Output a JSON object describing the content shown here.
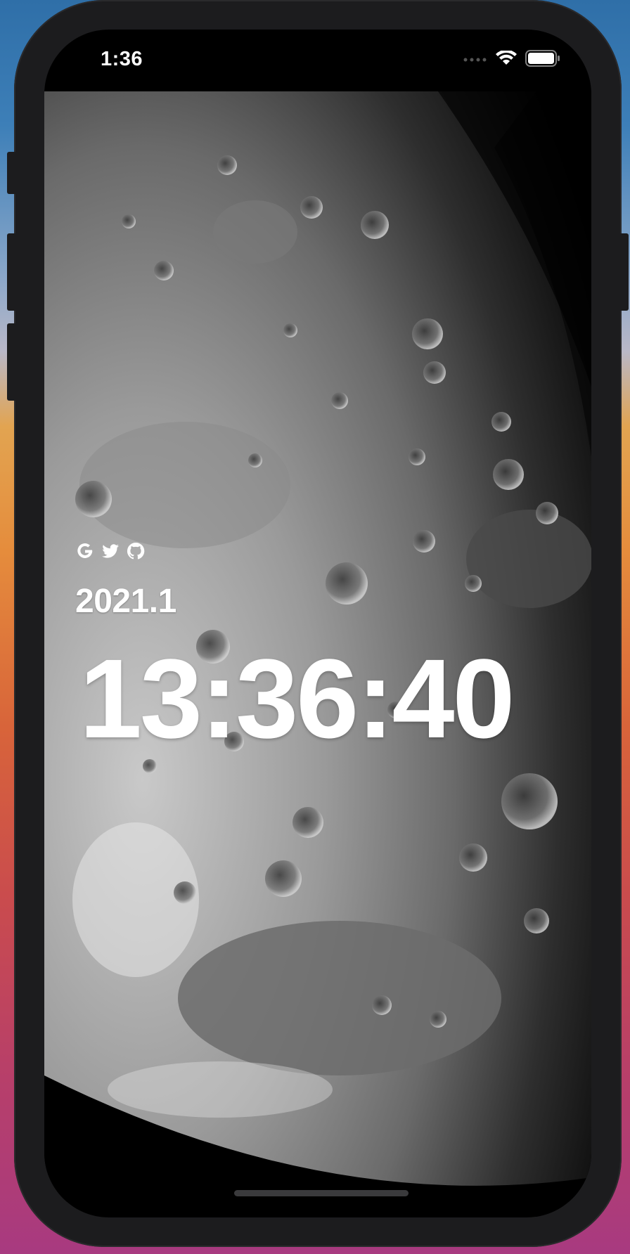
{
  "status_bar": {
    "time": "1:36",
    "signal_icon": "signal-dots-icon",
    "wifi_icon": "wifi-icon",
    "battery_icon": "battery-icon"
  },
  "social_links": [
    {
      "name": "google",
      "icon": "google-icon"
    },
    {
      "name": "twitter",
      "icon": "twitter-icon"
    },
    {
      "name": "github",
      "icon": "github-icon"
    }
  ],
  "date_text": "2021.1",
  "clock_text": "13:36:40",
  "colors": {
    "text": "#ffffff",
    "frame": "#1c1c1e",
    "screen_bg": "#000000"
  }
}
